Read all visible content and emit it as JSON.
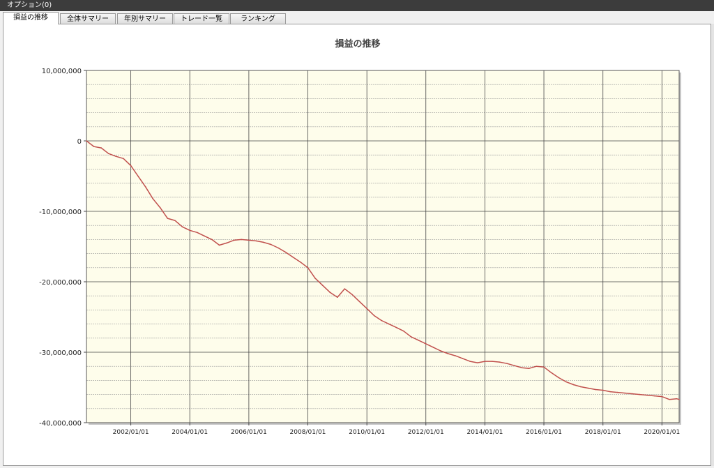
{
  "window": {
    "title": "オプション(0)"
  },
  "tabs": [
    {
      "label": "損益の推移",
      "active": true
    },
    {
      "label": "全体サマリー",
      "active": false
    },
    {
      "label": "年別サマリー",
      "active": false
    },
    {
      "label": "トレード一覧",
      "active": false
    },
    {
      "label": "ランキング",
      "active": false
    }
  ],
  "chart_data": {
    "type": "line",
    "title": "損益の推移",
    "xlabel": "",
    "ylabel": "",
    "x_range": [
      "2000/07/01",
      "2020/08/01"
    ],
    "ylim": [
      -40000000,
      10000000
    ],
    "y_ticks": [
      10000000,
      0,
      -10000000,
      -20000000,
      -30000000,
      -40000000
    ],
    "y_tick_labels": [
      "10,000,000",
      "0",
      "-10,000,000",
      "-20,000,000",
      "-30,000,000",
      "-40,000,000"
    ],
    "x_tick_labels": [
      "2002/01/01",
      "2004/01/01",
      "2006/01/01",
      "2008/01/01",
      "2010/01/01",
      "2012/01/01",
      "2014/01/01",
      "2016/01/01",
      "2018/01/01",
      "2020/01/01"
    ],
    "grid": true,
    "legend": "none",
    "colors": {
      "line": "#c0504d",
      "plot_bg": "#fefdeb",
      "grid_major": "#444444",
      "grid_minor": "#9b9b9b"
    },
    "series": [
      {
        "values": [
          [
            "2000/07/01",
            0
          ],
          [
            "2000/10/01",
            -800000
          ],
          [
            "2001/01/01",
            -1000000
          ],
          [
            "2001/04/01",
            -1800000
          ],
          [
            "2001/07/01",
            -2200000
          ],
          [
            "2001/10/01",
            -2500000
          ],
          [
            "2002/01/01",
            -3500000
          ],
          [
            "2002/04/01",
            -5000000
          ],
          [
            "2002/07/01",
            -6500000
          ],
          [
            "2002/10/01",
            -8200000
          ],
          [
            "2003/01/01",
            -9500000
          ],
          [
            "2003/04/01",
            -11000000
          ],
          [
            "2003/07/01",
            -11300000
          ],
          [
            "2003/10/01",
            -12200000
          ],
          [
            "2004/01/01",
            -12700000
          ],
          [
            "2004/04/01",
            -13000000
          ],
          [
            "2004/07/01",
            -13500000
          ],
          [
            "2004/10/01",
            -14000000
          ],
          [
            "2005/01/01",
            -14800000
          ],
          [
            "2005/04/01",
            -14500000
          ],
          [
            "2005/07/01",
            -14100000
          ],
          [
            "2005/10/01",
            -14000000
          ],
          [
            "2006/01/01",
            -14100000
          ],
          [
            "2006/04/01",
            -14200000
          ],
          [
            "2006/07/01",
            -14400000
          ],
          [
            "2006/10/01",
            -14700000
          ],
          [
            "2007/01/01",
            -15200000
          ],
          [
            "2007/04/01",
            -15800000
          ],
          [
            "2007/07/01",
            -16500000
          ],
          [
            "2007/10/01",
            -17200000
          ],
          [
            "2008/01/01",
            -18000000
          ],
          [
            "2008/04/01",
            -19500000
          ],
          [
            "2008/07/01",
            -20500000
          ],
          [
            "2008/10/01",
            -21500000
          ],
          [
            "2009/01/01",
            -22200000
          ],
          [
            "2009/04/01",
            -21000000
          ],
          [
            "2009/07/01",
            -21800000
          ],
          [
            "2009/10/01",
            -22800000
          ],
          [
            "2010/01/01",
            -23800000
          ],
          [
            "2010/04/01",
            -24800000
          ],
          [
            "2010/07/01",
            -25500000
          ],
          [
            "2010/10/01",
            -26000000
          ],
          [
            "2011/01/01",
            -26500000
          ],
          [
            "2011/04/01",
            -27000000
          ],
          [
            "2011/07/01",
            -27800000
          ],
          [
            "2011/10/01",
            -28300000
          ],
          [
            "2012/01/01",
            -28800000
          ],
          [
            "2012/04/01",
            -29300000
          ],
          [
            "2012/07/01",
            -29800000
          ],
          [
            "2012/10/01",
            -30200000
          ],
          [
            "2013/01/01",
            -30500000
          ],
          [
            "2013/04/01",
            -30900000
          ],
          [
            "2013/07/01",
            -31300000
          ],
          [
            "2013/10/01",
            -31500000
          ],
          [
            "2014/01/01",
            -31300000
          ],
          [
            "2014/04/01",
            -31300000
          ],
          [
            "2014/07/01",
            -31400000
          ],
          [
            "2014/10/01",
            -31600000
          ],
          [
            "2015/01/01",
            -31900000
          ],
          [
            "2015/04/01",
            -32200000
          ],
          [
            "2015/07/01",
            -32300000
          ],
          [
            "2015/10/01",
            -32000000
          ],
          [
            "2016/01/01",
            -32100000
          ],
          [
            "2016/04/01",
            -32900000
          ],
          [
            "2016/07/01",
            -33600000
          ],
          [
            "2016/10/01",
            -34200000
          ],
          [
            "2017/01/01",
            -34600000
          ],
          [
            "2017/04/01",
            -34900000
          ],
          [
            "2017/07/01",
            -35100000
          ],
          [
            "2017/10/01",
            -35300000
          ],
          [
            "2018/01/01",
            -35400000
          ],
          [
            "2018/04/01",
            -35600000
          ],
          [
            "2018/07/01",
            -35700000
          ],
          [
            "2018/10/01",
            -35800000
          ],
          [
            "2019/01/01",
            -35900000
          ],
          [
            "2019/04/01",
            -36000000
          ],
          [
            "2019/07/01",
            -36100000
          ],
          [
            "2019/10/01",
            -36200000
          ],
          [
            "2020/01/01",
            -36300000
          ],
          [
            "2020/04/01",
            -36700000
          ],
          [
            "2020/07/01",
            -36600000
          ],
          [
            "2020/08/01",
            -36700000
          ]
        ]
      }
    ]
  }
}
